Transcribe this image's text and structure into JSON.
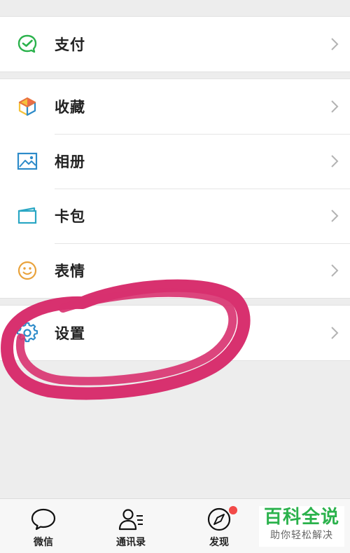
{
  "menu": {
    "pay": {
      "label": "支付",
      "icon": "pay-icon"
    },
    "favorites": {
      "label": "收藏",
      "icon": "cube-icon"
    },
    "album": {
      "label": "相册",
      "icon": "image-icon"
    },
    "cards": {
      "label": "卡包",
      "icon": "card-icon"
    },
    "stickers": {
      "label": "表情",
      "icon": "smiley-icon"
    },
    "settings": {
      "label": "设置",
      "icon": "gear-icon"
    }
  },
  "tabbar": {
    "tabs": [
      {
        "label": "微信",
        "icon": "chat-bubble-icon"
      },
      {
        "label": "通讯录",
        "icon": "contacts-icon"
      },
      {
        "label": "发现",
        "icon": "compass-icon",
        "badge": true
      },
      {
        "label": "",
        "icon": "me-icon"
      }
    ]
  },
  "watermark": {
    "title": "百科全说",
    "subtitle": "助你轻松解决"
  },
  "colors": {
    "background": "#ededed",
    "accent_green": "#2bb24c",
    "annotation_pink": "#d8316f",
    "badge_red": "#f24a48",
    "icon_blue": "#2d8bc9",
    "icon_orange": "#e9a23b"
  }
}
